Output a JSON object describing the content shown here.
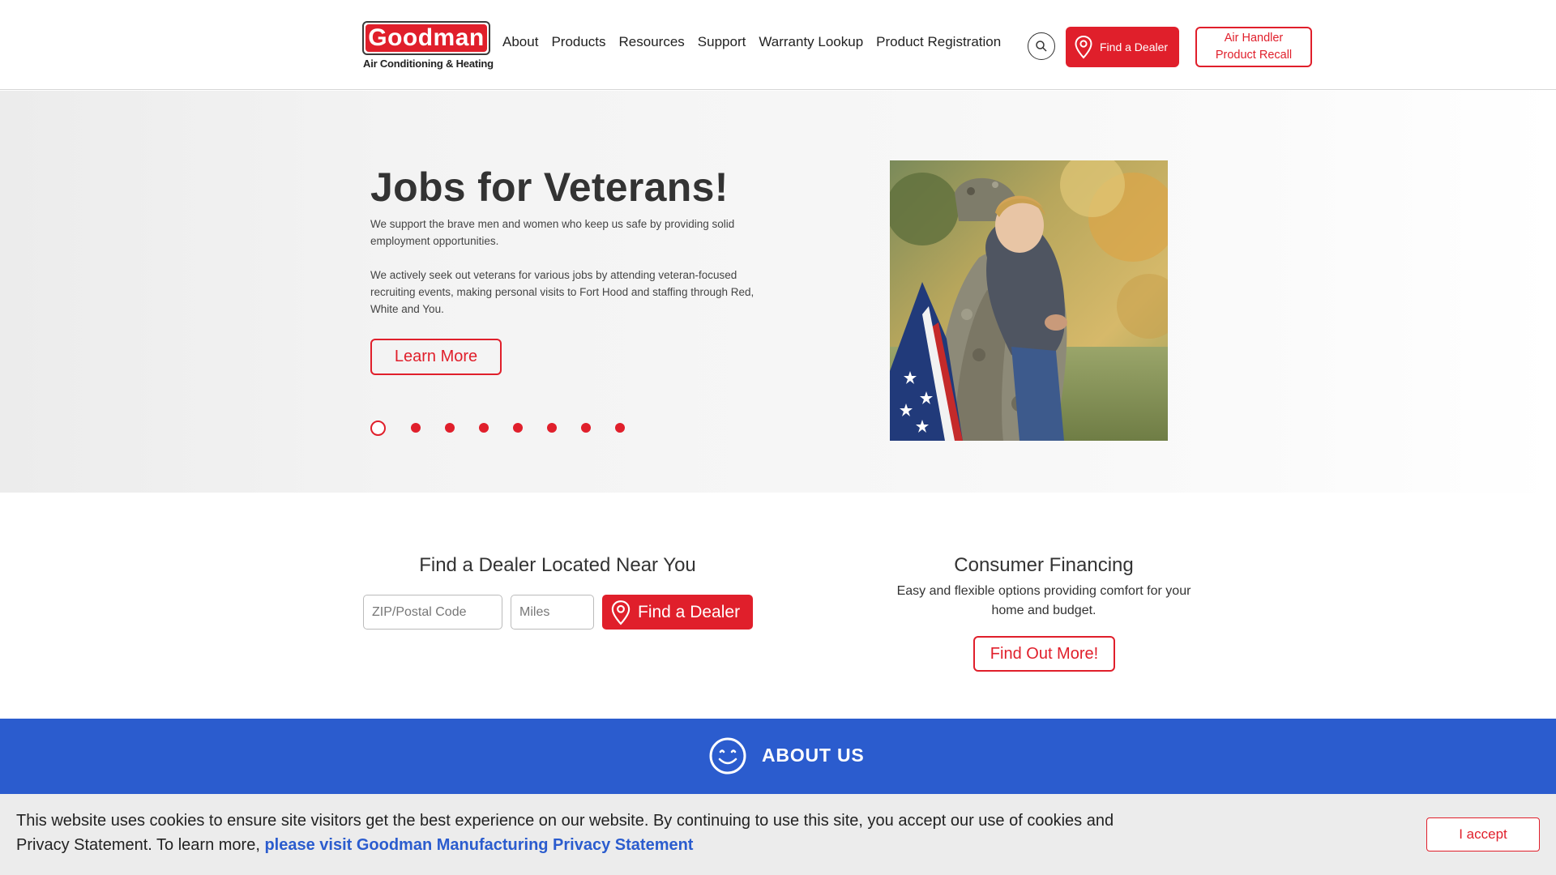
{
  "header": {
    "logo_text": "Goodman",
    "logo_tagline": "Air Conditioning & Heating",
    "nav": [
      "About",
      "Products",
      "Resources",
      "Support",
      "Warranty Lookup",
      "Product Registration"
    ],
    "find_dealer_label": "Find a Dealer",
    "recall_line1": "Air Handler",
    "recall_line2": "Product Recall"
  },
  "hero": {
    "title": "Jobs for Veterans!",
    "paragraph1": "We support the brave men and women who keep us safe by providing solid employment opportunities.",
    "paragraph2": "We actively seek out veterans for various jobs by attending veteran-focused recruiting events, making personal visits to Fort Hood and staffing through Red, White and You.",
    "button_label": "Learn More",
    "carousel": {
      "total": 8,
      "active_index": 0
    }
  },
  "dealer": {
    "title": "Find a Dealer Located Near You",
    "zip_placeholder": "ZIP/Postal Code",
    "miles_placeholder": "Miles",
    "button_label": "Find a Dealer"
  },
  "financing": {
    "title": "Consumer Financing",
    "text": "Easy and flexible options providing comfort for your home and budget.",
    "button_label": "Find Out More!"
  },
  "about": {
    "label": "ABOUT US"
  },
  "cookie": {
    "text": "This website uses cookies to ensure site visitors get the best experience on our website. By continuing to use this site, you accept our use of cookies and Privacy Statement. To learn more,",
    "link": "please visit Goodman Manufacturing Privacy Statement",
    "accept_label": "I accept"
  },
  "colors": {
    "brand_red": "#e01f2b",
    "about_blue": "#2b5cce",
    "link_blue": "#2b5cce"
  },
  "icons": [
    "search-icon",
    "map-pin-icon",
    "smiley-icon"
  ]
}
